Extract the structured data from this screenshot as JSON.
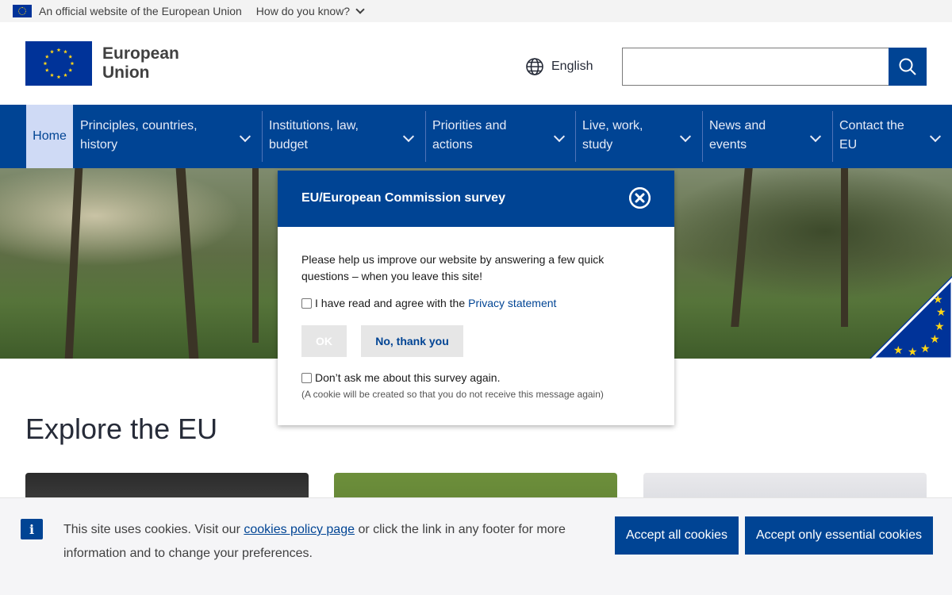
{
  "official_bar": {
    "text": "An official website of the European Union",
    "how_know": "How do you know?"
  },
  "header": {
    "logo_line1": "European",
    "logo_line2": "Union",
    "language": "English",
    "search_placeholder": ""
  },
  "nav": {
    "home": "Home",
    "items": [
      {
        "line1": "Principles, countries,",
        "line2": "history"
      },
      {
        "line1": "Institutions, law,",
        "line2": "budget"
      },
      {
        "line1": "Priorities and",
        "line2": "actions"
      },
      {
        "line1": "Live, work,",
        "line2": "study"
      },
      {
        "line1": "News and",
        "line2": "events"
      },
      {
        "line1": "Contact the",
        "line2": "EU"
      }
    ]
  },
  "explore": {
    "title": "Explore the EU"
  },
  "survey": {
    "title": "EU/European Commission survey",
    "body_line1": "Please help us improve our website by answering a few quick",
    "body_line2": "questions – when you leave this site!",
    "agree_text": "I have read and agree with the",
    "privacy_link": "Privacy statement",
    "ok_label": "OK",
    "no_label": "No, thank you",
    "dont_ask": "Don’t ask me about this survey again.",
    "note": "(A cookie will be created so that you do not receive this message again)"
  },
  "cookie": {
    "text_before": "This site uses cookies. Visit our ",
    "link": "cookies policy page",
    "text_after": " or click the link in any footer for more information and to change your preferences.",
    "accept_all": "Accept all cookies",
    "accept_essential": "Accept only essential cookies"
  },
  "colors": {
    "eu_blue": "#004494",
    "flag_blue": "#003399",
    "flag_yellow": "#ffd617",
    "nav_home_bg": "#cfdaf5"
  }
}
